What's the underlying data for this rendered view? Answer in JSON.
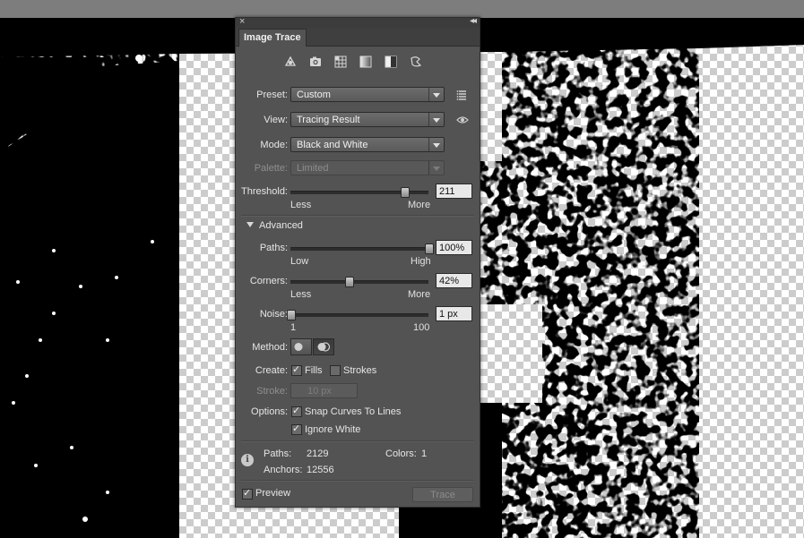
{
  "panel": {
    "close_glyph": "×",
    "collapse_glyph": "◂◂",
    "tab_label": "Image Trace",
    "preset_icons": [
      "auto-color-icon",
      "high-color-icon",
      "low-color-icon",
      "grayscale-icon",
      "black-and-white-icon",
      "outline-icon"
    ],
    "preset": {
      "label": "Preset:",
      "value": "Custom"
    },
    "view": {
      "label": "View:",
      "value": "Tracing Result"
    },
    "mode": {
      "label": "Mode:",
      "value": "Black and White"
    },
    "palette": {
      "label": "Palette:",
      "value": "Limited",
      "disabled": true
    },
    "threshold": {
      "label": "Threshold:",
      "value": "211",
      "fraction": 0.823,
      "min_label": "Less",
      "max_label": "More"
    },
    "advanced": {
      "label": "Advanced",
      "expanded": true
    },
    "paths": {
      "label": "Paths:",
      "value": "100%",
      "fraction": 1.0,
      "min_label": "Low",
      "max_label": "High"
    },
    "corners": {
      "label": "Corners:",
      "value": "42%",
      "fraction": 0.42,
      "min_label": "Less",
      "max_label": "More"
    },
    "noise": {
      "label": "Noise:",
      "value": "1 px",
      "fraction": 0.0,
      "min_label": "1",
      "max_label": "100"
    },
    "method": {
      "label": "Method:",
      "options": [
        "abutting",
        "overlapping"
      ],
      "selected": "overlapping"
    },
    "create": {
      "label": "Create:",
      "fills_label": "Fills",
      "fills": true,
      "strokes_label": "Strokes",
      "strokes": false
    },
    "stroke": {
      "label": "Stroke:",
      "value": "10 px",
      "disabled": true
    },
    "options": {
      "label": "Options:",
      "snap_label": "Snap Curves To Lines",
      "snap": true,
      "ignore_white_label": "Ignore White",
      "ignore_white": true
    },
    "stats": {
      "paths_label": "Paths:",
      "paths_value": "2129",
      "colors_label": "Colors:",
      "colors_value": "1",
      "anchors_label": "Anchors:",
      "anchors_value": "12556"
    },
    "preview": {
      "label": "Preview",
      "checked": true
    },
    "trace_button": "Trace"
  },
  "colors": {
    "panel_bg": "#535353",
    "selection_line": "#3f5fd6"
  }
}
